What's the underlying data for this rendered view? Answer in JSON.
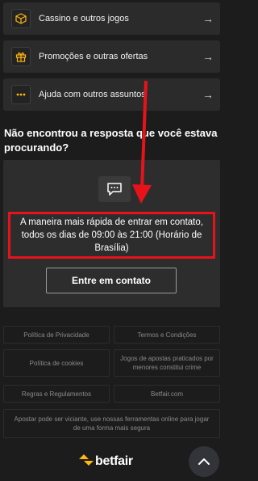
{
  "menu": [
    {
      "label": "Cassino e outros jogos",
      "icon": "cube-icon"
    },
    {
      "label": "Promoções e outras ofertas",
      "icon": "gift-icon"
    },
    {
      "label": "Ajuda com outros assuntos",
      "icon": "dots-icon"
    }
  ],
  "contact": {
    "question": "Não encontrou a resposta que você estava procurando?",
    "message": "A maneira mais rápida de entrar em contato, todos os dias de 09:00 às 21:00 (Horário de Brasília)",
    "button": "Entre em contato"
  },
  "footer": {
    "links": [
      "Política de Privacidade",
      "Termos e Condições",
      "Política de cookies",
      "Jogos de apostas praticados por menores constitui crime",
      "Regras e Regulamentos",
      "Betfair.com"
    ],
    "disclaimer": "Apostar pode ser viciante, use nossas ferramentas online para jogar de uma forma mais segura",
    "brand": "betfair"
  },
  "colors": {
    "background": "#1c1c1c",
    "card": "#2b2b2b",
    "highlight": "#e8121a",
    "brand_accent": "#ffb80c"
  }
}
